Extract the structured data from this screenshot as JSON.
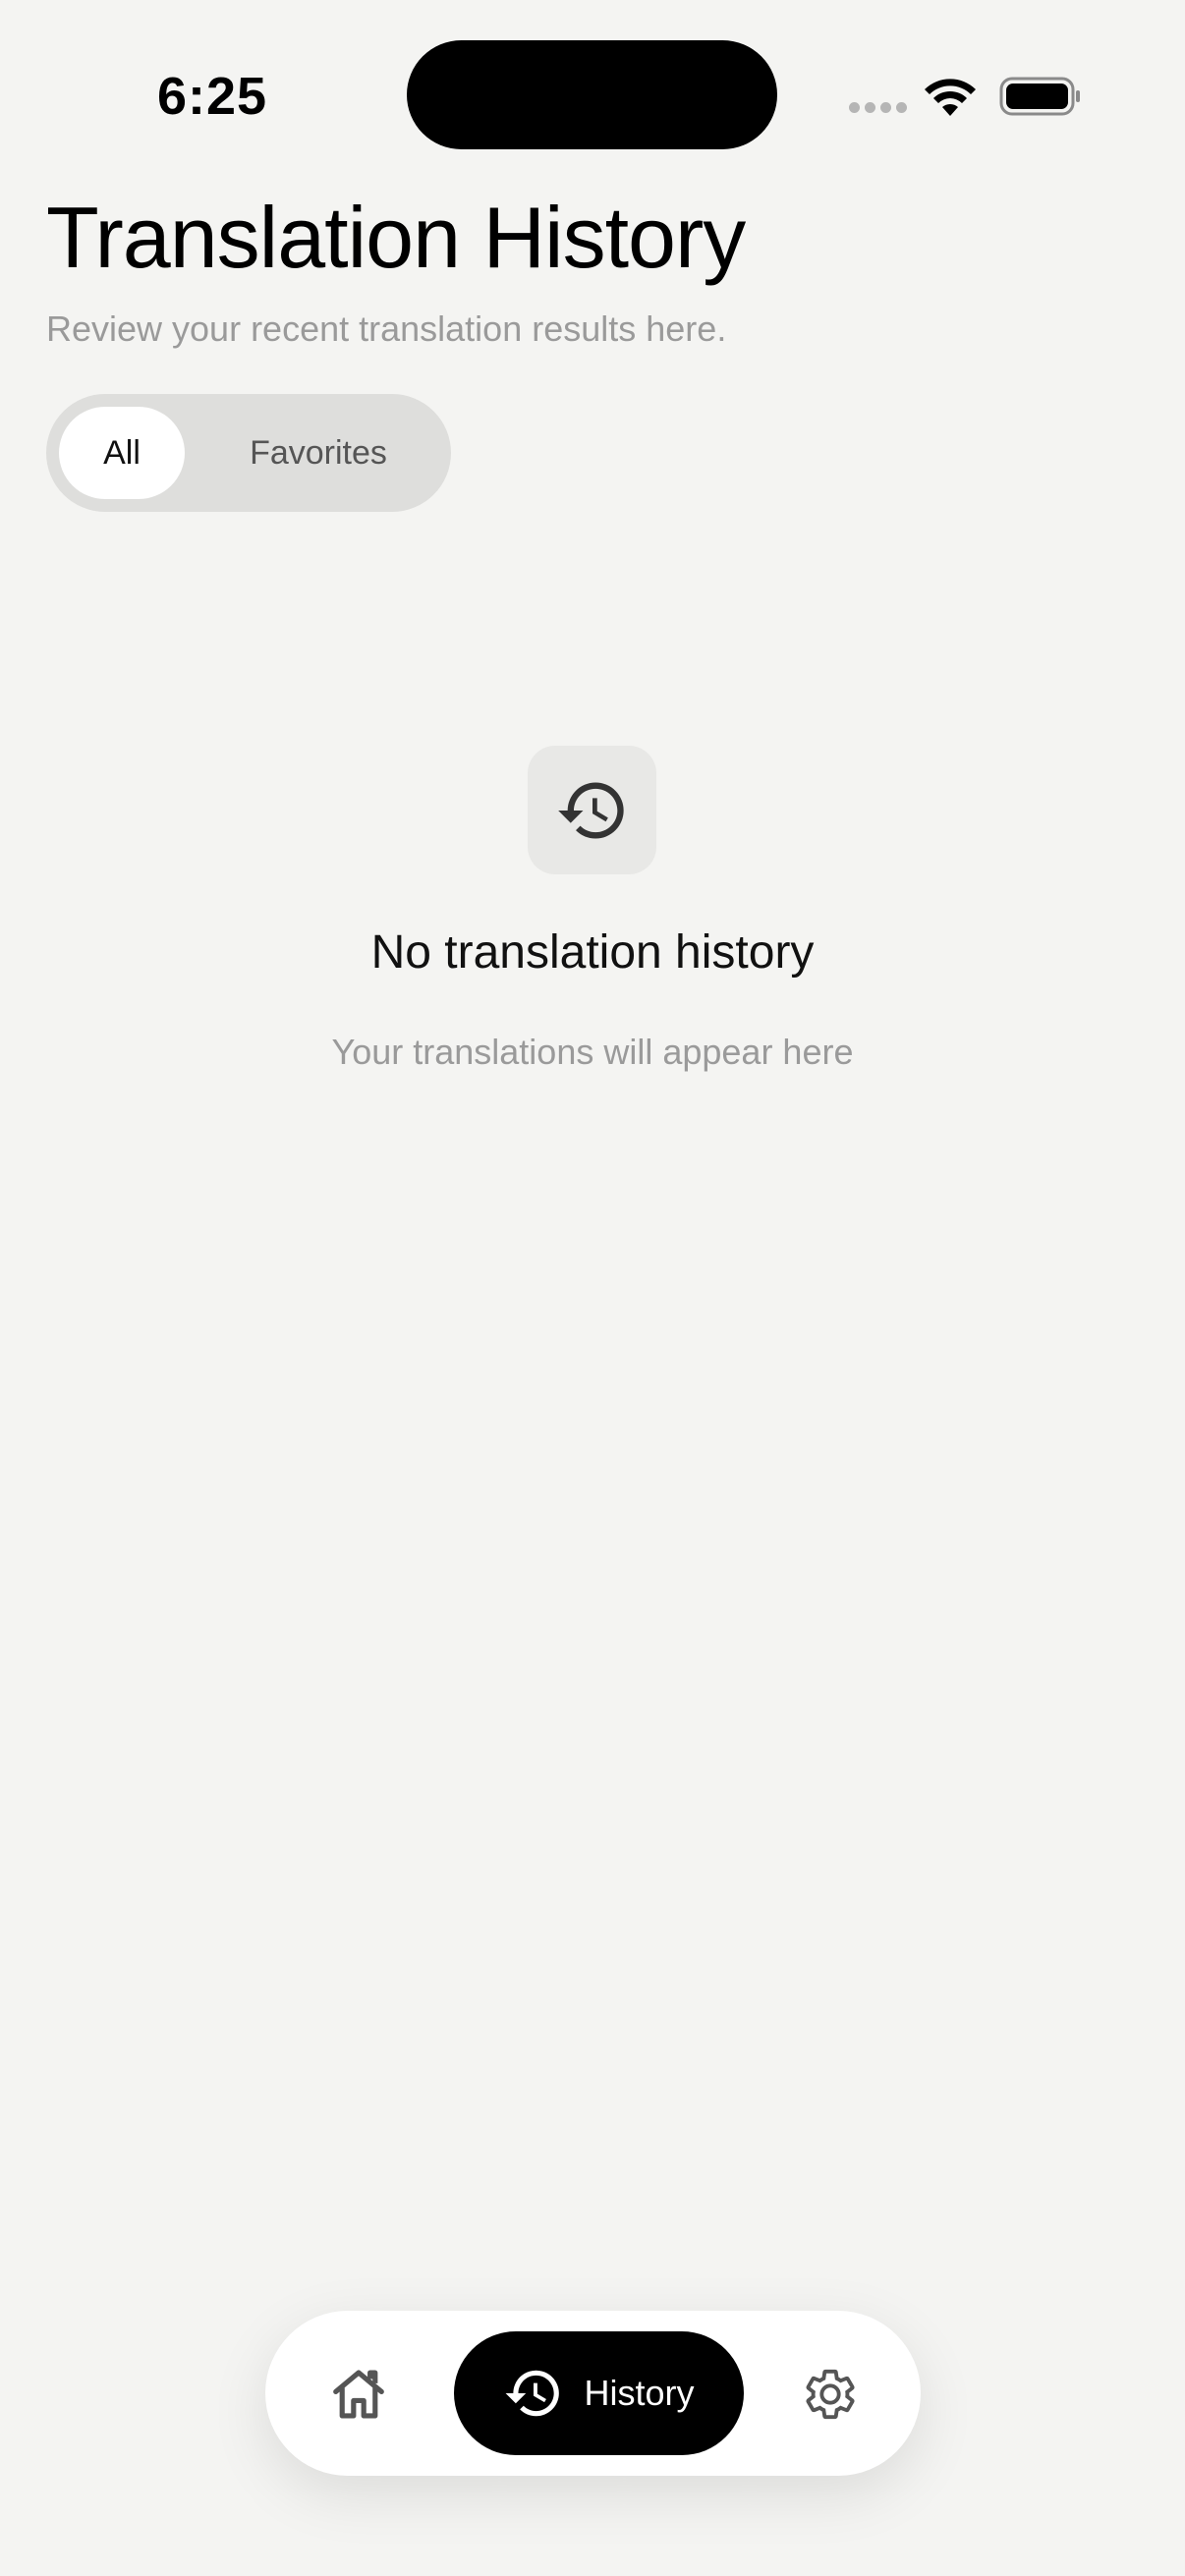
{
  "status_bar": {
    "time": "6:25"
  },
  "header": {
    "title": "Translation History",
    "subtitle": "Review your recent translation results here."
  },
  "filter": {
    "options": [
      {
        "label": "All",
        "selected": true
      },
      {
        "label": "Favorites",
        "selected": false
      }
    ]
  },
  "empty_state": {
    "icon": "history-icon",
    "title": "No translation history",
    "message": "Your translations will appear here"
  },
  "tab_bar": {
    "items": [
      {
        "icon": "home-icon",
        "label": "",
        "active": false
      },
      {
        "icon": "history-icon",
        "label": "History",
        "active": true
      },
      {
        "icon": "gear-icon",
        "label": "",
        "active": false
      }
    ]
  },
  "colors": {
    "background": "#f4f4f2",
    "accent": "#000000",
    "muted_text": "#9a9a9a",
    "segment_track": "#dededc"
  }
}
